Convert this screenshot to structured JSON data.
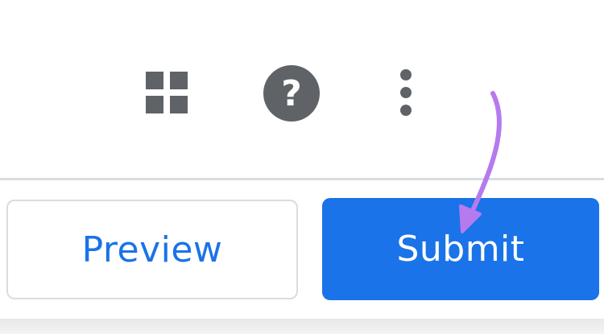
{
  "toolbar": {
    "icons": [
      {
        "name": "apps-grid-icon",
        "color": "#5f6368"
      },
      {
        "name": "help-icon",
        "color": "#5f6368",
        "glyph": "?"
      },
      {
        "name": "more-vert-icon",
        "color": "#5f6368"
      }
    ]
  },
  "actions": {
    "preview_label": "Preview",
    "submit_label": "Submit"
  },
  "colors": {
    "primary": "#1a73e8",
    "icon_gray": "#5f6368",
    "border": "#dadce0",
    "annotation_arrow": "#b57bee"
  }
}
